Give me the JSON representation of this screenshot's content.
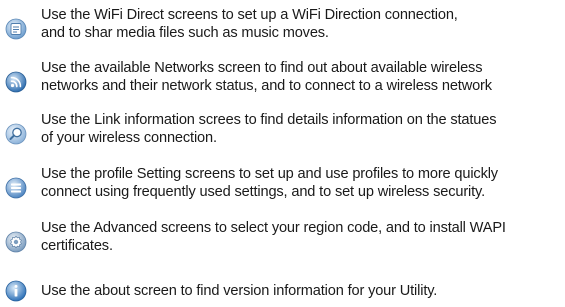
{
  "items": [
    {
      "icon": "wifi-direct-icon",
      "lines": [
        "Use the WiFi Direct screens to set up a WiFi Direction connection,",
        "and to shar media files such as music moves."
      ]
    },
    {
      "icon": "available-networks-icon",
      "lines": [
        "Use the available Networks screen to find out about available wireless",
        "networks and their network status, and to connect to a wireless network"
      ]
    },
    {
      "icon": "link-information-icon",
      "lines": [
        "Use the Link information screes to find details information on the statues",
        "of your wireless connection."
      ]
    },
    {
      "icon": "profile-setting-icon",
      "lines": [
        "Use the profile Setting screens to set up and use profiles to more quickly",
        "connect using frequently used settings, and to set up wireless security."
      ]
    },
    {
      "icon": "advanced-settings-icon",
      "lines": [
        "Use the Advanced screens to select your region code, and to install WAPI",
        "certificates."
      ]
    },
    {
      "icon": "about-info-icon",
      "lines": [
        "Use the about screen to find version information for your Utility."
      ]
    }
  ]
}
